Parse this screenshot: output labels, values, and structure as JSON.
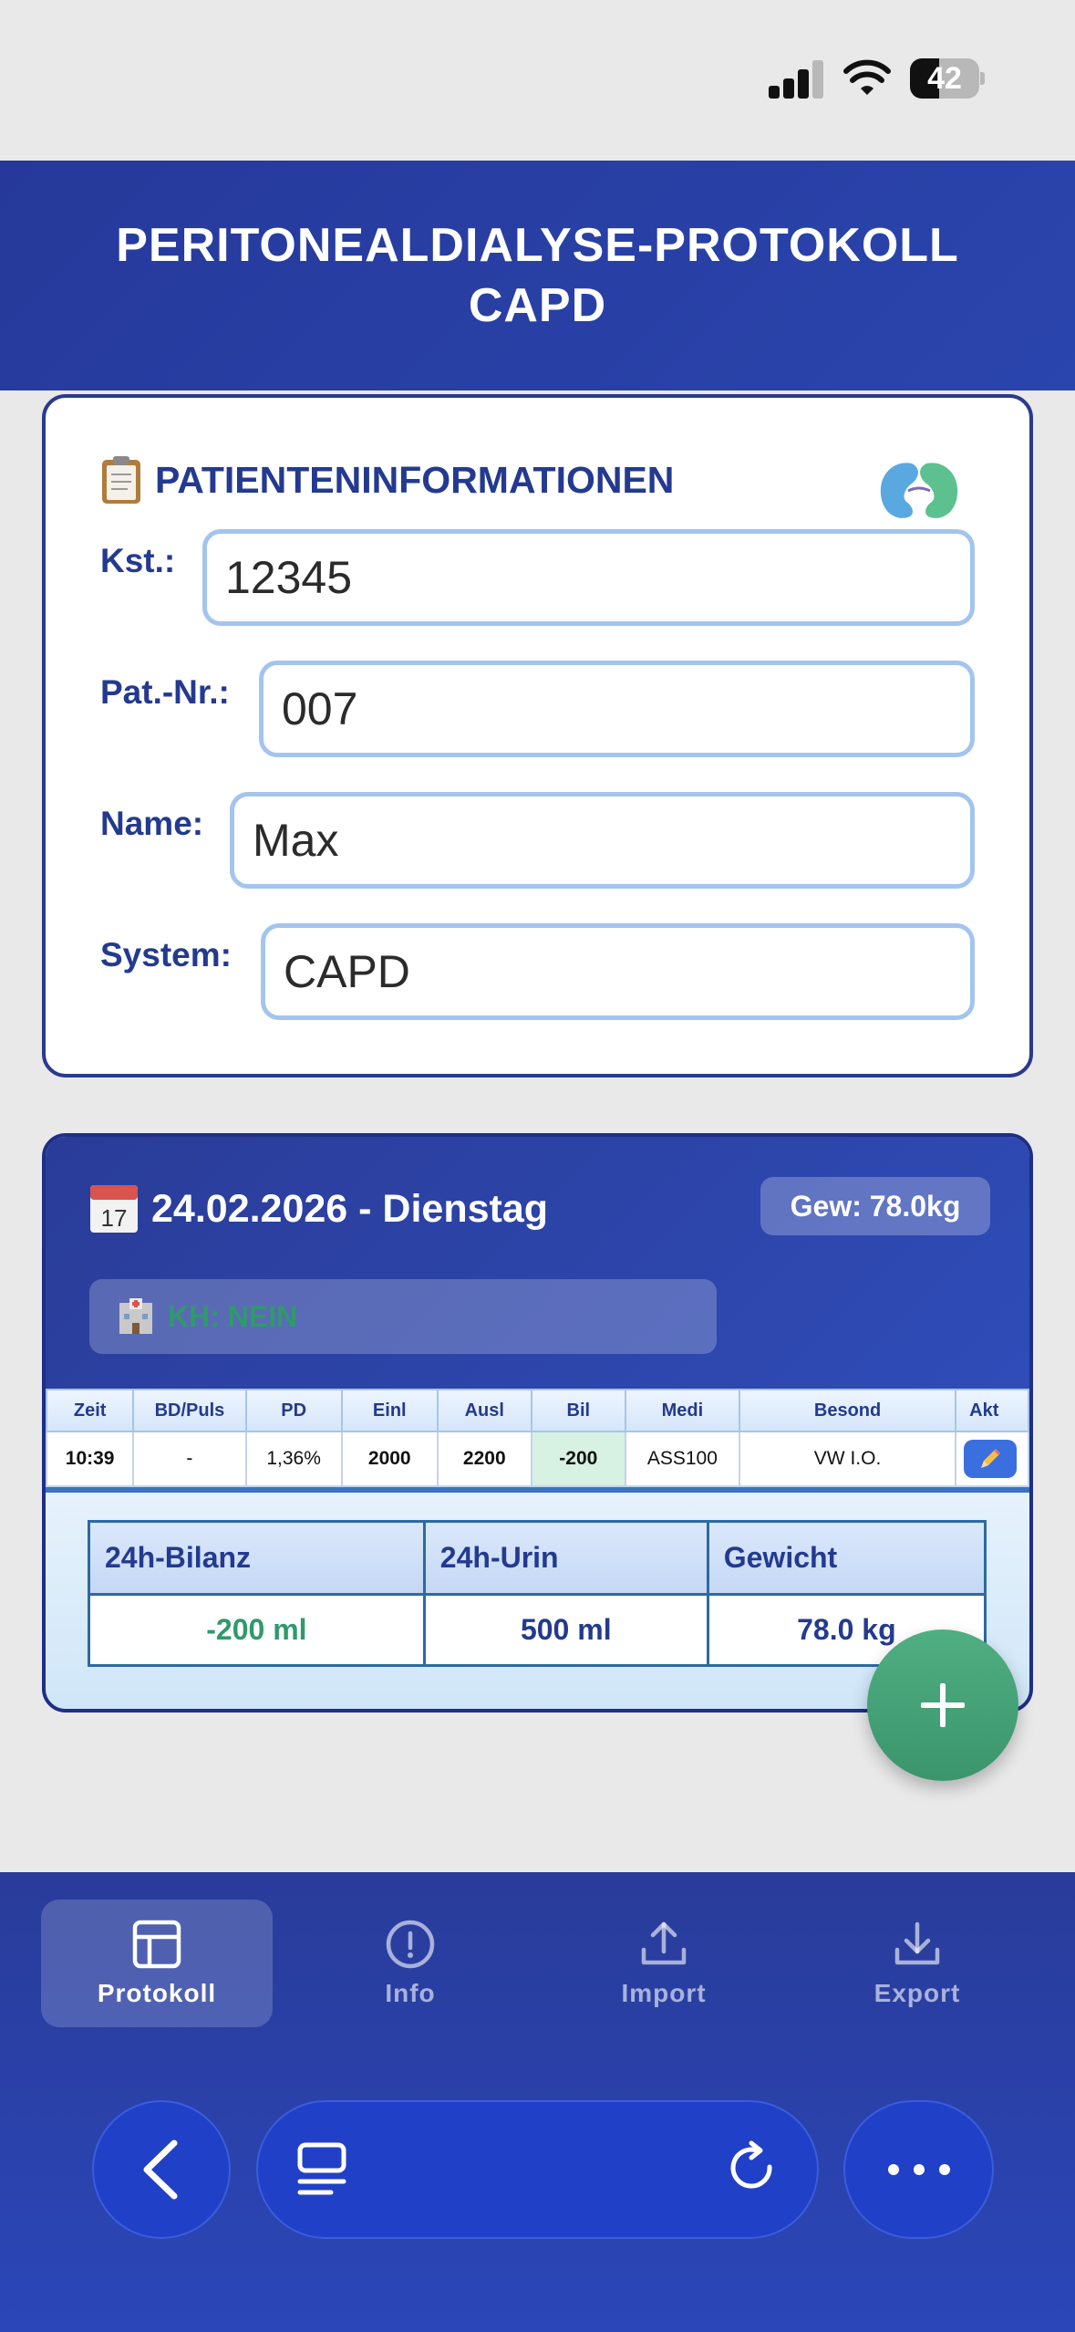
{
  "status_bar": {
    "battery_level": "42",
    "battery_fraction": 0.42
  },
  "header": {
    "title_line1": "PERITONEALDIALYSE-PROTOKOLL",
    "title_line2": "CAPD"
  },
  "patient": {
    "section_title": "PATIENTENINFORMATIONEN",
    "fields": [
      {
        "label": "Kst.:",
        "value": "12345"
      },
      {
        "label": "Pat.-Nr.:",
        "value": "007"
      },
      {
        "label": "Name:",
        "value": "Max"
      },
      {
        "label": "System:",
        "value": "CAPD"
      }
    ]
  },
  "day": {
    "date_title": "24.02.2026 - Dienstag",
    "weight_badge": "Gew: 78.0kg",
    "kh_status": "KH: NEIN",
    "table": {
      "headers": [
        "Zeit",
        "BD/Puls",
        "PD",
        "Einl",
        "Ausl",
        "Bil",
        "Medi",
        "Besond",
        "Akt"
      ],
      "rows": [
        {
          "zeit": "10:39",
          "bd_puls": "-",
          "pd": "1,36%",
          "einl": "2000",
          "ausl": "2200",
          "bil": "-200",
          "medi": "ASS100",
          "besond": "VW I.O."
        }
      ]
    },
    "summary": {
      "headers": [
        "24h-Bilanz",
        "24h-Urin",
        "Gewicht"
      ],
      "values": [
        "-200 ml",
        "500 ml",
        "78.0 kg"
      ]
    }
  },
  "nav": {
    "items": [
      {
        "label": "Protokoll",
        "icon": "table-icon",
        "active": true
      },
      {
        "label": "Info",
        "icon": "info-icon",
        "active": false
      },
      {
        "label": "Import",
        "icon": "upload-icon",
        "active": false
      },
      {
        "label": "Export",
        "icon": "download-icon",
        "active": false
      }
    ]
  },
  "colors": {
    "brand": "#26399a",
    "accent_green": "#3b956c",
    "border_blue": "#a3c4ee"
  }
}
